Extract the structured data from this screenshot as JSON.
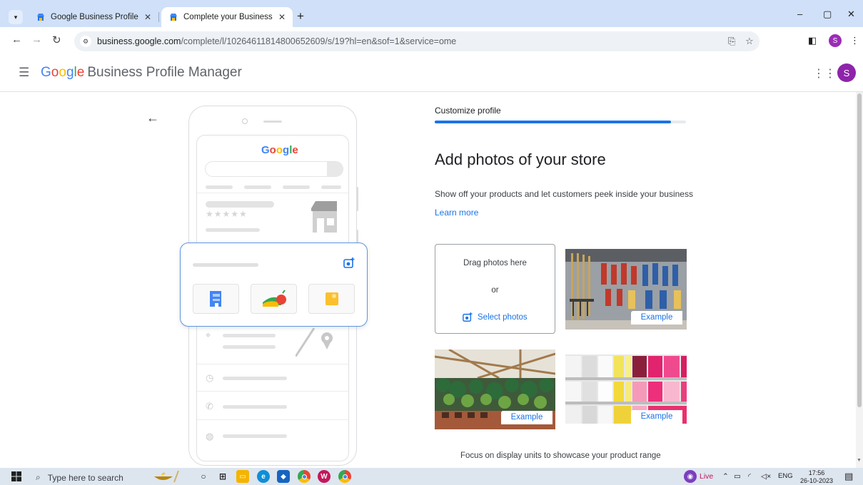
{
  "browser": {
    "tabs": [
      {
        "label": "Google Business Profile – Get L",
        "active": false
      },
      {
        "label": "Complete your Business Profile",
        "active": true
      }
    ],
    "new_tab": "+",
    "url_host": "business.google.com",
    "url_path": "/complete/l/10264611814800652609/s/19?hl=en&sof=1&service=ome",
    "profile_initial": "S",
    "window_controls": {
      "minimize": "–",
      "maximize": "▢",
      "close": "✕"
    }
  },
  "header": {
    "brand_google": "Google",
    "brand_product": "Business Profile Manager",
    "avatar_initial": "S"
  },
  "illustration": {
    "mini_logo": "Google"
  },
  "main": {
    "step_label": "Customize profile",
    "progress": 0.94,
    "title": "Add photos of your store",
    "subtitle": "Show off your products and let customers peek inside your business",
    "learn_more": "Learn more",
    "dropzone": {
      "drag_text": "Drag photos here",
      "or_text": "or",
      "select_label": "Select photos"
    },
    "examples": [
      {
        "label": "Example",
        "subject": "tools-wall"
      },
      {
        "label": "Example",
        "subject": "plant-nursery"
      },
      {
        "label": "Example",
        "subject": "candles-shelf"
      }
    ],
    "footer_note": "Focus on display units to showcase your product range"
  },
  "taskbar": {
    "search_placeholder": "Type here to search",
    "live_label": "Live",
    "lang": "ENG",
    "time": "17:56",
    "date": "26-10-2023"
  },
  "colors": {
    "accent": "#1a73e8",
    "tabstrip": "#cfe0f8",
    "avatar": "#8e24aa"
  }
}
